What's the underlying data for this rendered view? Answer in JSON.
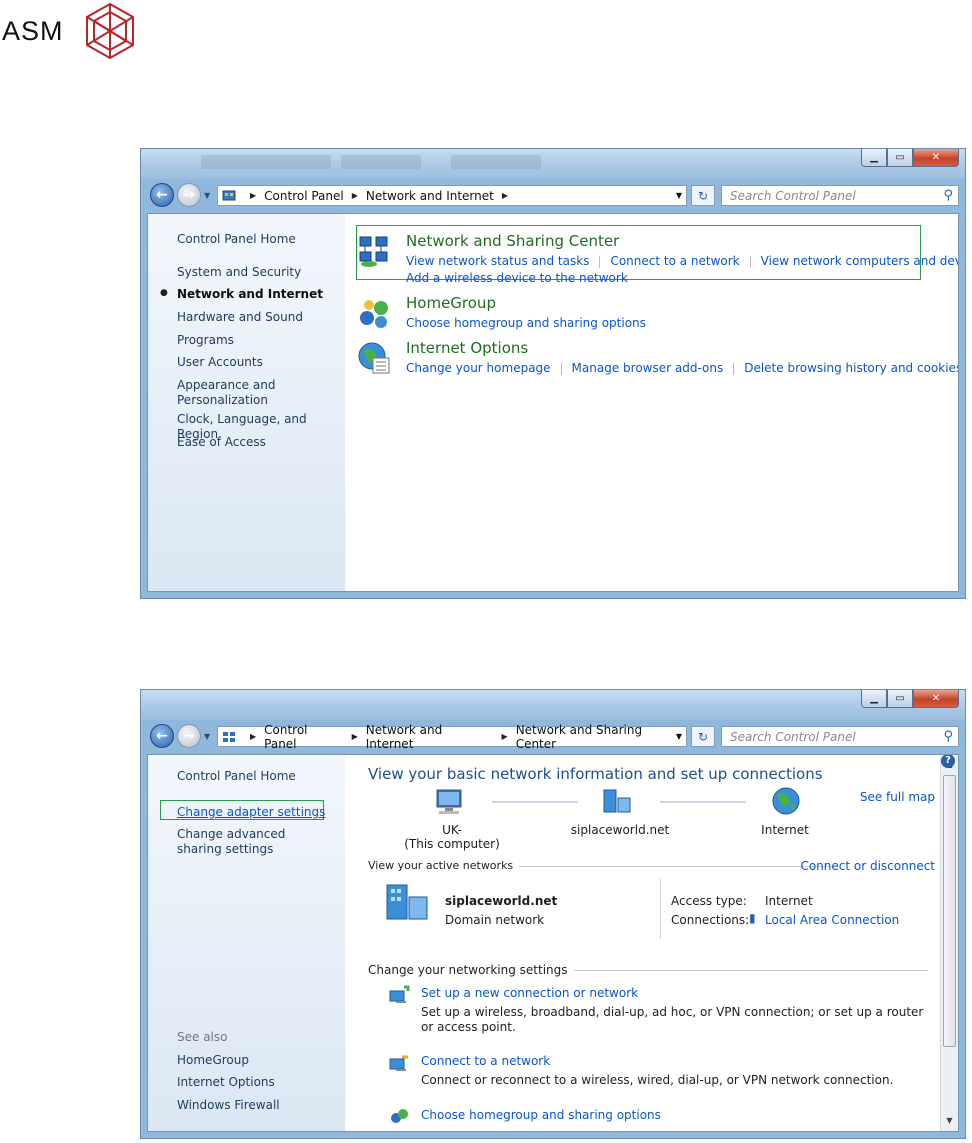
{
  "logo": {
    "text": "ASM"
  },
  "window1": {
    "breadcrumb": [
      "Control Panel",
      "Network and Internet"
    ],
    "search_placeholder": "Search Control Panel",
    "sidebar": {
      "home": "Control Panel Home",
      "items": [
        "System and Security",
        "Network and Internet",
        "Hardware and Sound",
        "Programs",
        "User Accounts",
        "Appearance and Personalization",
        "Clock, Language, and Region",
        "Ease of Access"
      ],
      "current": "Network and Internet"
    },
    "categories": [
      {
        "title": "Network and Sharing Center",
        "icon": "network-sharing-icon",
        "links": [
          "View network status and tasks",
          "Connect to a network",
          "View network computers and devices"
        ],
        "links2": [
          "Add a wireless device to the network"
        ]
      },
      {
        "title": "HomeGroup",
        "icon": "homegroup-icon",
        "links": [
          "Choose homegroup and sharing options"
        ]
      },
      {
        "title": "Internet Options",
        "icon": "internet-options-icon",
        "links": [
          "Change your homepage",
          "Manage browser add-ons",
          "Delete browsing history and cookies"
        ]
      }
    ]
  },
  "window2": {
    "breadcrumb": [
      "Control Panel",
      "Network and Internet",
      "Network and Sharing Center"
    ],
    "search_placeholder": "Search Control Panel",
    "sidebar": {
      "home": "Control Panel Home",
      "change_adapter": "Change adapter settings",
      "change_advanced": "Change advanced sharing settings",
      "see_also": "See also",
      "see_also_items": [
        "HomeGroup",
        "Internet Options",
        "Windows Firewall"
      ]
    },
    "main": {
      "heading": "View your basic network information and set up connections",
      "see_full_map": "See full map",
      "map": {
        "computer": "UK-",
        "computer_sub": "(This computer)",
        "domain": "siplaceworld.net",
        "internet": "Internet"
      },
      "active_networks_label": "View your active networks",
      "connect_disconnect": "Connect or disconnect",
      "network_name": "siplaceworld.net",
      "network_type": "Domain network",
      "access_type_label": "Access type:",
      "access_type_value": "Internet",
      "connections_label": "Connections:",
      "connections_value": "Local Area Connection",
      "change_settings_label": "Change your networking settings",
      "tasks": [
        {
          "title": "Set up a new connection or network",
          "desc": "Set up a wireless, broadband, dial-up, ad hoc, or VPN connection; or set up a router or access point."
        },
        {
          "title": "Connect to a network",
          "desc": "Connect or reconnect to a wireless, wired, dial-up, or VPN network connection."
        },
        {
          "title": "Choose homegroup and sharing options",
          "desc": ""
        }
      ]
    }
  },
  "colors": {
    "link": "#0a55c9",
    "category_title": "#1e6e1e",
    "heading": "#1e4e8c",
    "highlight_box": "#2a9a4a"
  }
}
